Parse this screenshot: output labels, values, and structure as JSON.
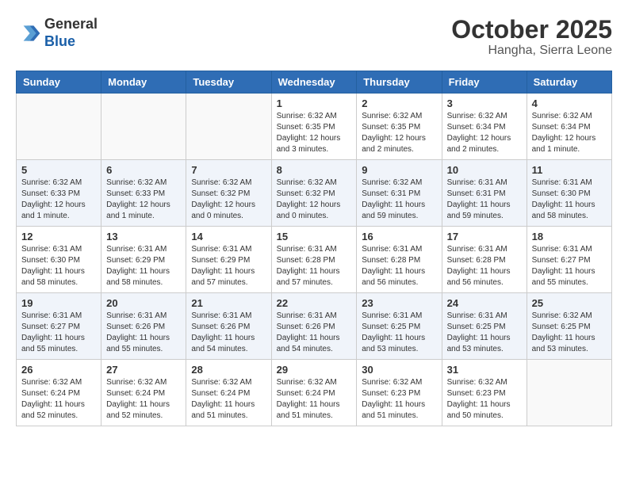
{
  "logo": {
    "line1": "General",
    "line2": "Blue"
  },
  "title": "October 2025",
  "subtitle": "Hangha, Sierra Leone",
  "weekdays": [
    "Sunday",
    "Monday",
    "Tuesday",
    "Wednesday",
    "Thursday",
    "Friday",
    "Saturday"
  ],
  "weeks": [
    [
      {
        "day": "",
        "sunrise": "",
        "sunset": "",
        "daylight": ""
      },
      {
        "day": "",
        "sunrise": "",
        "sunset": "",
        "daylight": ""
      },
      {
        "day": "",
        "sunrise": "",
        "sunset": "",
        "daylight": ""
      },
      {
        "day": "1",
        "sunrise": "Sunrise: 6:32 AM",
        "sunset": "Sunset: 6:35 PM",
        "daylight": "Daylight: 12 hours and 3 minutes."
      },
      {
        "day": "2",
        "sunrise": "Sunrise: 6:32 AM",
        "sunset": "Sunset: 6:35 PM",
        "daylight": "Daylight: 12 hours and 2 minutes."
      },
      {
        "day": "3",
        "sunrise": "Sunrise: 6:32 AM",
        "sunset": "Sunset: 6:34 PM",
        "daylight": "Daylight: 12 hours and 2 minutes."
      },
      {
        "day": "4",
        "sunrise": "Sunrise: 6:32 AM",
        "sunset": "Sunset: 6:34 PM",
        "daylight": "Daylight: 12 hours and 1 minute."
      }
    ],
    [
      {
        "day": "5",
        "sunrise": "Sunrise: 6:32 AM",
        "sunset": "Sunset: 6:33 PM",
        "daylight": "Daylight: 12 hours and 1 minute."
      },
      {
        "day": "6",
        "sunrise": "Sunrise: 6:32 AM",
        "sunset": "Sunset: 6:33 PM",
        "daylight": "Daylight: 12 hours and 1 minute."
      },
      {
        "day": "7",
        "sunrise": "Sunrise: 6:32 AM",
        "sunset": "Sunset: 6:32 PM",
        "daylight": "Daylight: 12 hours and 0 minutes."
      },
      {
        "day": "8",
        "sunrise": "Sunrise: 6:32 AM",
        "sunset": "Sunset: 6:32 PM",
        "daylight": "Daylight: 12 hours and 0 minutes."
      },
      {
        "day": "9",
        "sunrise": "Sunrise: 6:32 AM",
        "sunset": "Sunset: 6:31 PM",
        "daylight": "Daylight: 11 hours and 59 minutes."
      },
      {
        "day": "10",
        "sunrise": "Sunrise: 6:31 AM",
        "sunset": "Sunset: 6:31 PM",
        "daylight": "Daylight: 11 hours and 59 minutes."
      },
      {
        "day": "11",
        "sunrise": "Sunrise: 6:31 AM",
        "sunset": "Sunset: 6:30 PM",
        "daylight": "Daylight: 11 hours and 58 minutes."
      }
    ],
    [
      {
        "day": "12",
        "sunrise": "Sunrise: 6:31 AM",
        "sunset": "Sunset: 6:30 PM",
        "daylight": "Daylight: 11 hours and 58 minutes."
      },
      {
        "day": "13",
        "sunrise": "Sunrise: 6:31 AM",
        "sunset": "Sunset: 6:29 PM",
        "daylight": "Daylight: 11 hours and 58 minutes."
      },
      {
        "day": "14",
        "sunrise": "Sunrise: 6:31 AM",
        "sunset": "Sunset: 6:29 PM",
        "daylight": "Daylight: 11 hours and 57 minutes."
      },
      {
        "day": "15",
        "sunrise": "Sunrise: 6:31 AM",
        "sunset": "Sunset: 6:28 PM",
        "daylight": "Daylight: 11 hours and 57 minutes."
      },
      {
        "day": "16",
        "sunrise": "Sunrise: 6:31 AM",
        "sunset": "Sunset: 6:28 PM",
        "daylight": "Daylight: 11 hours and 56 minutes."
      },
      {
        "day": "17",
        "sunrise": "Sunrise: 6:31 AM",
        "sunset": "Sunset: 6:28 PM",
        "daylight": "Daylight: 11 hours and 56 minutes."
      },
      {
        "day": "18",
        "sunrise": "Sunrise: 6:31 AM",
        "sunset": "Sunset: 6:27 PM",
        "daylight": "Daylight: 11 hours and 55 minutes."
      }
    ],
    [
      {
        "day": "19",
        "sunrise": "Sunrise: 6:31 AM",
        "sunset": "Sunset: 6:27 PM",
        "daylight": "Daylight: 11 hours and 55 minutes."
      },
      {
        "day": "20",
        "sunrise": "Sunrise: 6:31 AM",
        "sunset": "Sunset: 6:26 PM",
        "daylight": "Daylight: 11 hours and 55 minutes."
      },
      {
        "day": "21",
        "sunrise": "Sunrise: 6:31 AM",
        "sunset": "Sunset: 6:26 PM",
        "daylight": "Daylight: 11 hours and 54 minutes."
      },
      {
        "day": "22",
        "sunrise": "Sunrise: 6:31 AM",
        "sunset": "Sunset: 6:26 PM",
        "daylight": "Daylight: 11 hours and 54 minutes."
      },
      {
        "day": "23",
        "sunrise": "Sunrise: 6:31 AM",
        "sunset": "Sunset: 6:25 PM",
        "daylight": "Daylight: 11 hours and 53 minutes."
      },
      {
        "day": "24",
        "sunrise": "Sunrise: 6:31 AM",
        "sunset": "Sunset: 6:25 PM",
        "daylight": "Daylight: 11 hours and 53 minutes."
      },
      {
        "day": "25",
        "sunrise": "Sunrise: 6:32 AM",
        "sunset": "Sunset: 6:25 PM",
        "daylight": "Daylight: 11 hours and 53 minutes."
      }
    ],
    [
      {
        "day": "26",
        "sunrise": "Sunrise: 6:32 AM",
        "sunset": "Sunset: 6:24 PM",
        "daylight": "Daylight: 11 hours and 52 minutes."
      },
      {
        "day": "27",
        "sunrise": "Sunrise: 6:32 AM",
        "sunset": "Sunset: 6:24 PM",
        "daylight": "Daylight: 11 hours and 52 minutes."
      },
      {
        "day": "28",
        "sunrise": "Sunrise: 6:32 AM",
        "sunset": "Sunset: 6:24 PM",
        "daylight": "Daylight: 11 hours and 51 minutes."
      },
      {
        "day": "29",
        "sunrise": "Sunrise: 6:32 AM",
        "sunset": "Sunset: 6:24 PM",
        "daylight": "Daylight: 11 hours and 51 minutes."
      },
      {
        "day": "30",
        "sunrise": "Sunrise: 6:32 AM",
        "sunset": "Sunset: 6:23 PM",
        "daylight": "Daylight: 11 hours and 51 minutes."
      },
      {
        "day": "31",
        "sunrise": "Sunrise: 6:32 AM",
        "sunset": "Sunset: 6:23 PM",
        "daylight": "Daylight: 11 hours and 50 minutes."
      },
      {
        "day": "",
        "sunrise": "",
        "sunset": "",
        "daylight": ""
      }
    ]
  ]
}
